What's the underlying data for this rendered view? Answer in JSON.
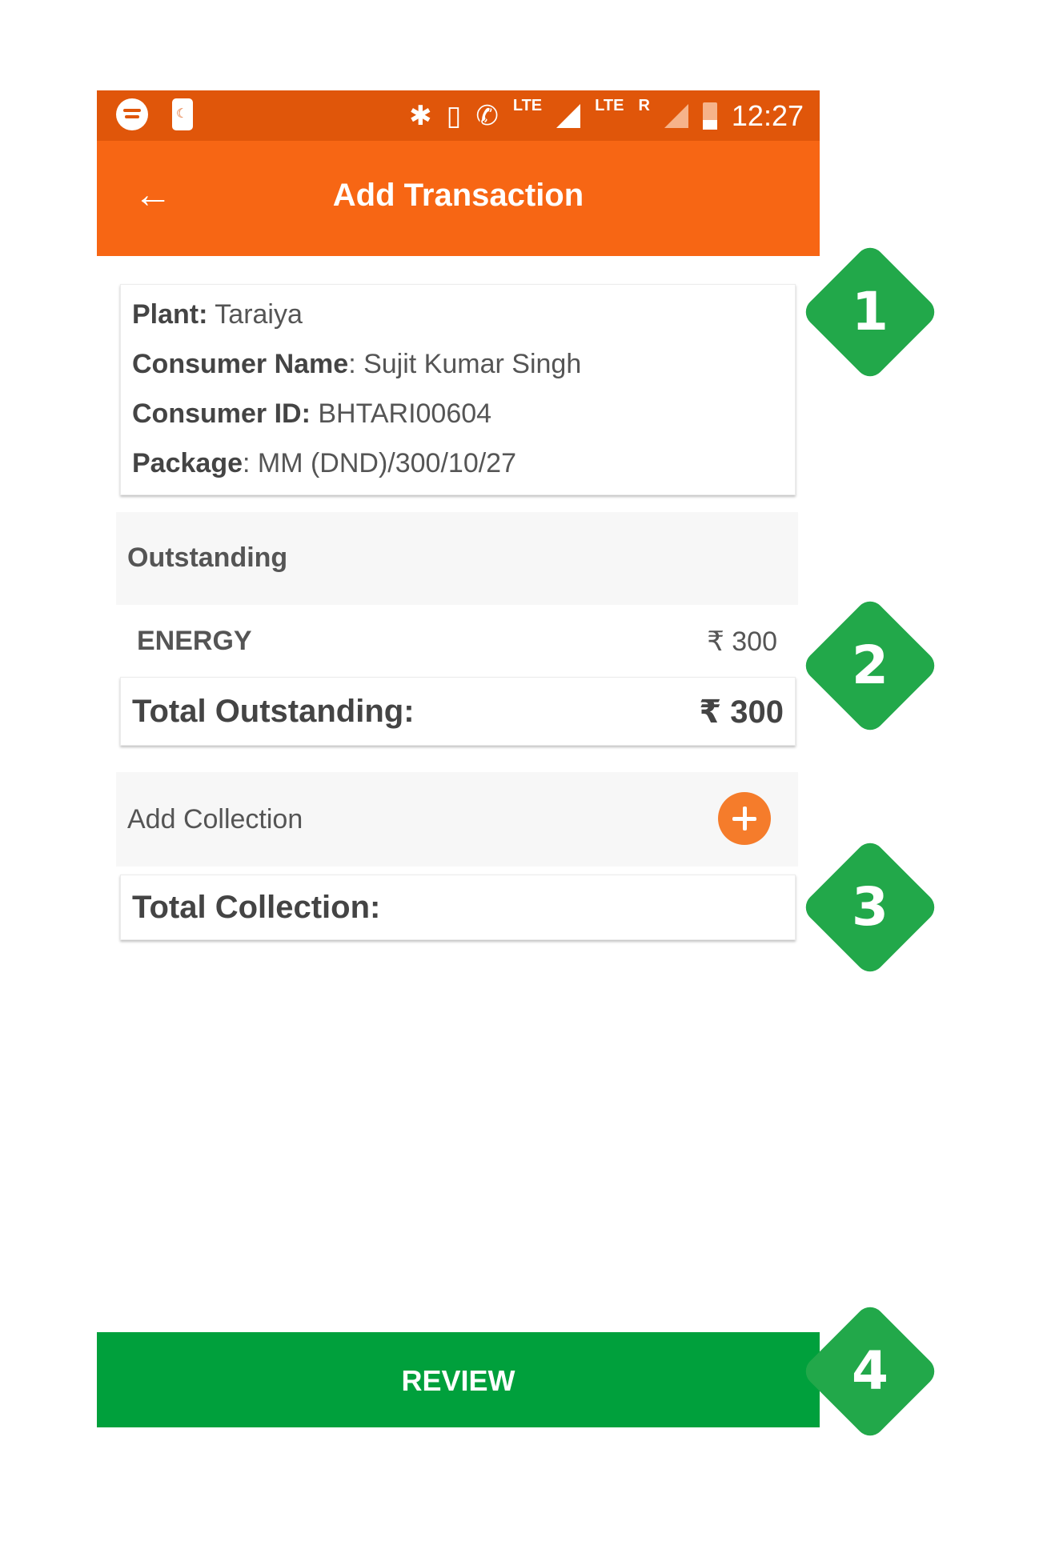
{
  "status_bar": {
    "time": "12:27",
    "lte1": "LTE",
    "lte2": "LTE",
    "roaming": "R",
    "icons": [
      "spotify-icon",
      "phone-case-icon",
      "bluetooth-icon",
      "vibrate-icon",
      "volte-call-icon",
      "signal-icon",
      "signal-roaming-icon",
      "battery-icon"
    ]
  },
  "app_bar": {
    "title": "Add Transaction",
    "back_icon": "arrow-left-icon"
  },
  "consumer_info": {
    "plant_label": "Plant:",
    "plant_value": " Taraiya",
    "name_label": "Consumer Name",
    "name_value": ": Sujit Kumar Singh",
    "id_label": "Consumer ID:",
    "id_value": " BHTARI00604",
    "package_label": "Package",
    "package_value": ": MM (DND)/300/10/27"
  },
  "outstanding": {
    "heading": "Outstanding",
    "items": [
      {
        "label": "ENERGY",
        "value": "₹ 300"
      }
    ],
    "total_label": "Total Outstanding:",
    "total_value": "₹ 300"
  },
  "collection": {
    "add_label": "Add Collection",
    "add_icon": "plus-circle-icon",
    "total_label": "Total Collection:"
  },
  "review_button": "REVIEW",
  "markers": [
    "1",
    "2",
    "3",
    "4"
  ],
  "colors": {
    "status_bar": "#e0560a",
    "app_bar": "#f76614",
    "accent_button": "#f57c2b",
    "review": "#00a03c",
    "marker": "#22a84a"
  }
}
